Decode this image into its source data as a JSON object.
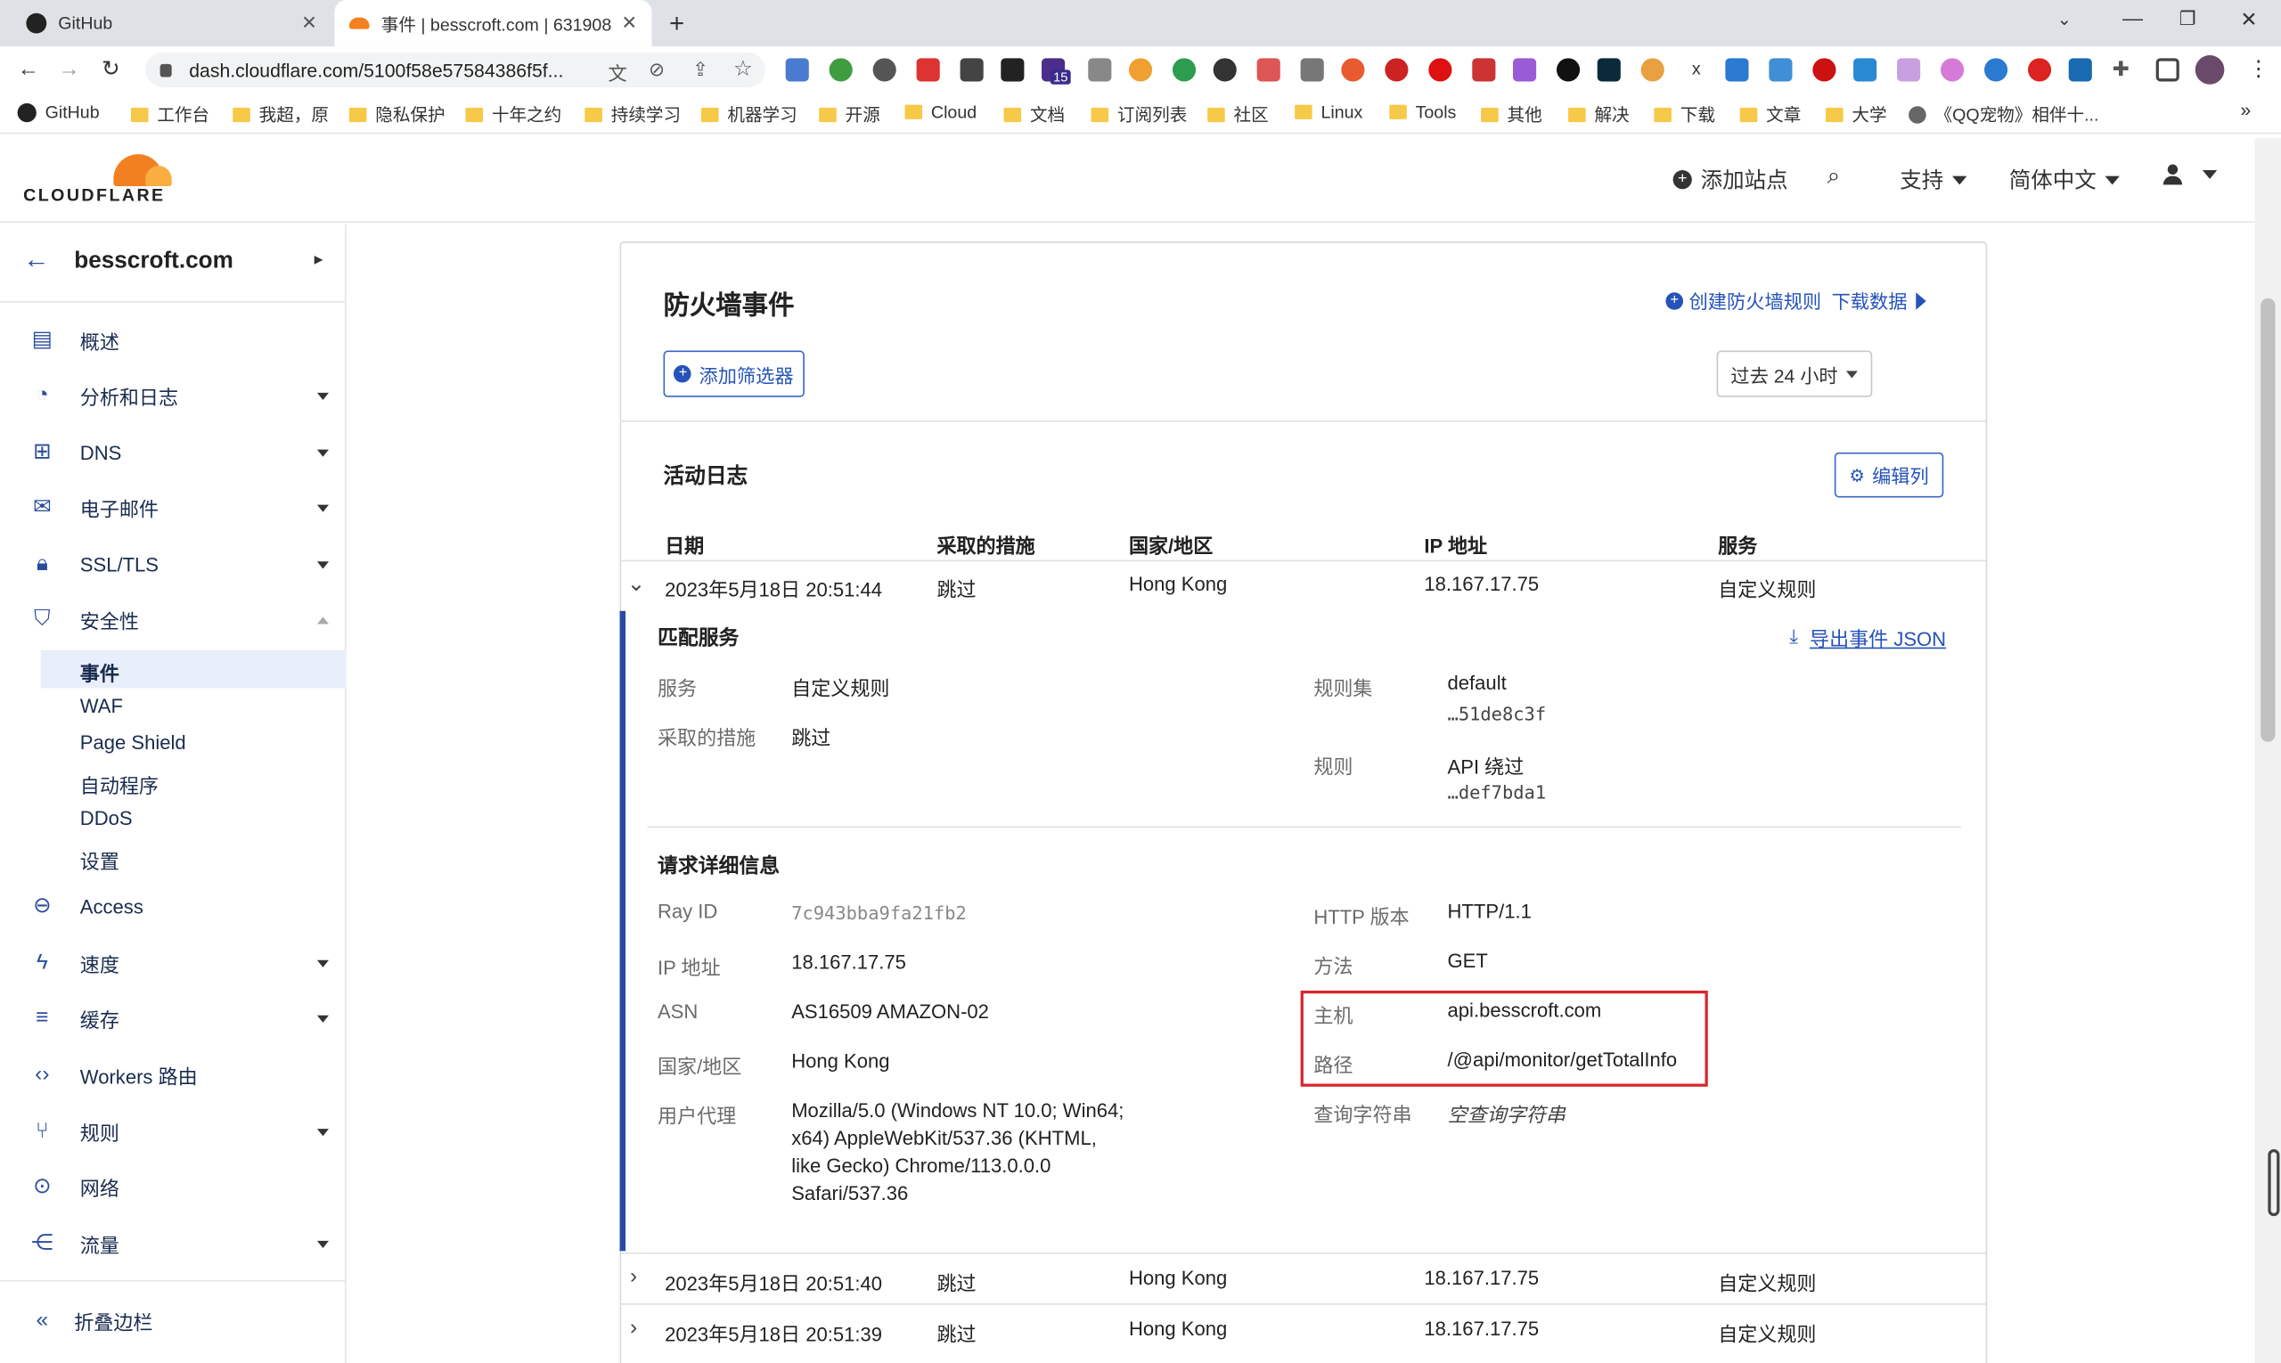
{
  "browser": {
    "tabs": [
      {
        "title": "GitHub"
      },
      {
        "title": "事件 | besscroft.com | 631908"
      }
    ],
    "url": "dash.cloudflare.com/5100f58e57584386f5f...",
    "bookmarks": [
      "GitHub",
      "工作台",
      "我超，原",
      "隐私保护",
      "十年之约",
      "持续学习",
      "机器学习",
      "开源",
      "Cloud",
      "文档",
      "订阅列表",
      "社区",
      "Linux",
      "Tools",
      "其他",
      "解决",
      "下载",
      "文章",
      "大学",
      "《QQ宠物》相伴十..."
    ],
    "ext_badge": "15"
  },
  "header": {
    "logo_text": "CLOUDFLARE",
    "add_site": "添加站点",
    "support": "支持",
    "language": "简体中文"
  },
  "sidebar": {
    "site": "besscroft.com",
    "items": [
      {
        "label": "概述",
        "icon": "document-icon"
      },
      {
        "label": "分析和日志",
        "icon": "clock-chart-icon"
      },
      {
        "label": "DNS",
        "icon": "network-icon"
      },
      {
        "label": "电子邮件",
        "icon": "mail-icon"
      },
      {
        "label": "SSL/TLS",
        "icon": "lock-icon"
      },
      {
        "label": "安全性",
        "icon": "shield-icon"
      }
    ],
    "security_sub": [
      "事件",
      "WAF",
      "Page Shield",
      "自动程序",
      "DDoS",
      "设置"
    ],
    "items2": [
      {
        "label": "Access",
        "icon": "access-icon"
      },
      {
        "label": "速度",
        "icon": "bolt-icon"
      },
      {
        "label": "缓存",
        "icon": "cache-icon"
      },
      {
        "label": "Workers 路由",
        "icon": "code-icon"
      },
      {
        "label": "规则",
        "icon": "rules-icon"
      },
      {
        "label": "网络",
        "icon": "pin-icon"
      },
      {
        "label": "流量",
        "icon": "traffic-icon"
      }
    ],
    "collapse": "折叠边栏"
  },
  "main": {
    "title": "防火墙事件",
    "create_rule": "创建防火墙规则",
    "download": "下载数据",
    "add_filter": "添加筛选器",
    "time_range": "过去 24 小时",
    "activity_log": "活动日志",
    "edit_columns": "编辑列",
    "columns": [
      "日期",
      "采取的措施",
      "国家/地区",
      "IP 地址",
      "服务"
    ],
    "rows": [
      {
        "date": "2023年5月18日 20:51:44",
        "action": "跳过",
        "country": "Hong Kong",
        "ip": "18.167.17.75",
        "service": "自定义规则"
      },
      {
        "date": "2023年5月18日 20:51:40",
        "action": "跳过",
        "country": "Hong Kong",
        "ip": "18.167.17.75",
        "service": "自定义规则"
      },
      {
        "date": "2023年5月18日 20:51:39",
        "action": "跳过",
        "country": "Hong Kong",
        "ip": "18.167.17.75",
        "service": "自定义规则"
      }
    ],
    "detail": {
      "match_title": "匹配服务",
      "export": "导出事件 JSON",
      "service_label": "服务",
      "service_value": "自定义规则",
      "action_label": "采取的措施",
      "action_value": "跳过",
      "ruleset_label": "规则集",
      "ruleset_value": "default",
      "ruleset_id": "…51de8c3f",
      "rule_label": "规则",
      "rule_value": "API 绕过",
      "rule_id": "…def7bda1",
      "request_title": "请求详细信息",
      "ray_label": "Ray ID",
      "ray_value": "7c943bba9fa21fb2",
      "ip_label": "IP 地址",
      "ip_value": "18.167.17.75",
      "asn_label": "ASN",
      "asn_value": "AS16509 AMAZON-02",
      "country_label": "国家/地区",
      "country_value": "Hong Kong",
      "ua_label": "用户代理",
      "ua_lines": [
        "Mozilla/5.0 (Windows NT 10.0; Win64;",
        "x64) AppleWebKit/537.36 (KHTML,",
        "like Gecko) Chrome/113.0.0.0",
        "Safari/537.36"
      ],
      "http_label": "HTTP 版本",
      "http_value": "HTTP/1.1",
      "method_label": "方法",
      "method_value": "GET",
      "host_label": "主机",
      "host_value": "api.besscroft.com",
      "path_label": "路径",
      "path_value": "/@api/monitor/getTotalInfo",
      "query_label": "查询字符串",
      "query_value": "空查询字符串"
    }
  }
}
